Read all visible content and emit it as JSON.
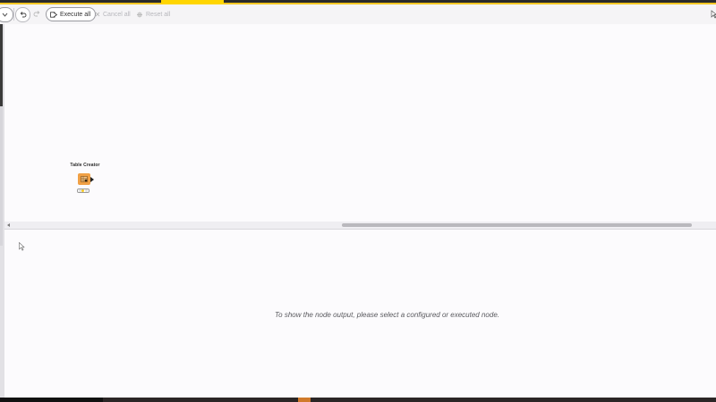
{
  "toolbar": {
    "execute_all_label": "Execute all",
    "cancel_all_label": "Cancel all",
    "reset_all_label": "Reset all"
  },
  "canvas": {
    "nodes": [
      {
        "title": "Table Creator",
        "color": "#f0a045",
        "status": "configured"
      }
    ]
  },
  "output_panel": {
    "message": "To show the node output, please select a configured or executed node."
  },
  "colors": {
    "accent": "#f3c623",
    "node_source": "#f0a045",
    "background": "#fcfbfd"
  },
  "icons": [
    "chevron-down-icon",
    "undo-icon",
    "redo-icon",
    "execute-all-icon",
    "cancel-all-icon",
    "reset-all-icon",
    "panel-toggle-icon",
    "mouse-cursor-icon"
  ]
}
